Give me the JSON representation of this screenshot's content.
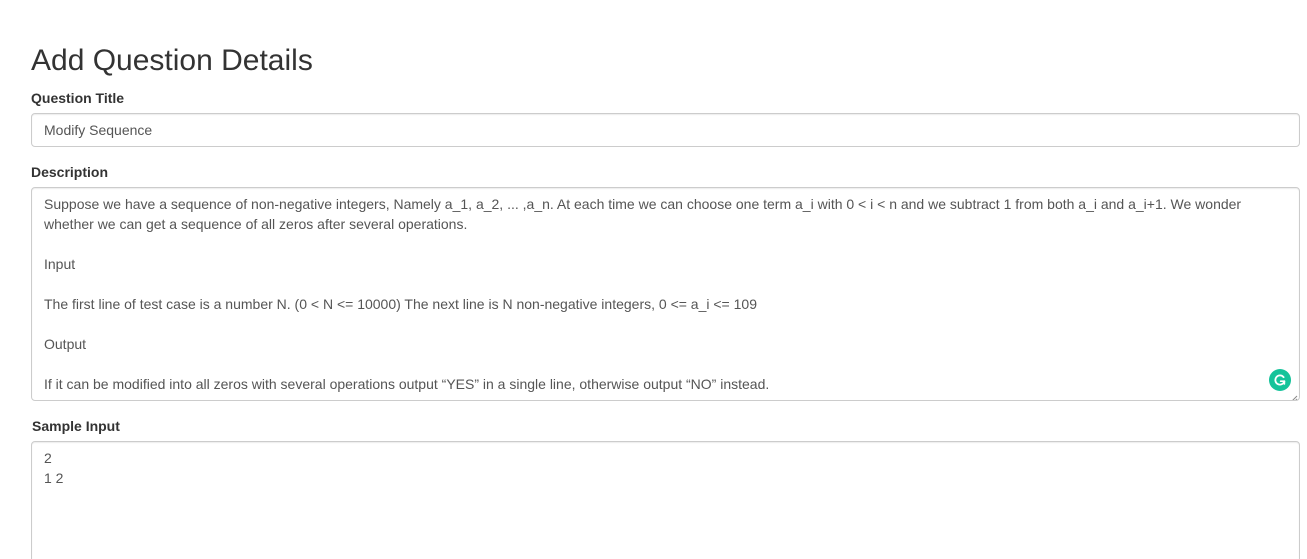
{
  "page": {
    "title": "Add Question Details"
  },
  "form": {
    "question_title": {
      "label": "Question Title",
      "value": "Modify Sequence"
    },
    "description": {
      "label": "Description",
      "value": "Suppose we have a sequence of non-negative integers, Namely a_1, a_2, ... ,a_n. At each time we can choose one term a_i with 0 < i < n and we subtract 1 from both a_i and a_i+1. We wonder whether we can get a sequence of all zeros after several operations.\n\nInput\n\nThe first line of test case is a number N. (0 < N <= 10000) The next line is N non-negative integers, 0 <= a_i <= 109\n\nOutput\n\nIf it can be modified into all zeros with several operations output “YES” in a single line, otherwise output “NO” instead."
    },
    "sample_input": {
      "label": "Sample Input",
      "value": "2\n1 2"
    }
  },
  "icons": {
    "grammarly": "grammarly-icon",
    "resize": "resize-handle-icon"
  },
  "colors": {
    "grammarly_green": "#15c39a",
    "border": "#cccccc",
    "text": "#555555",
    "heading": "#333333"
  }
}
